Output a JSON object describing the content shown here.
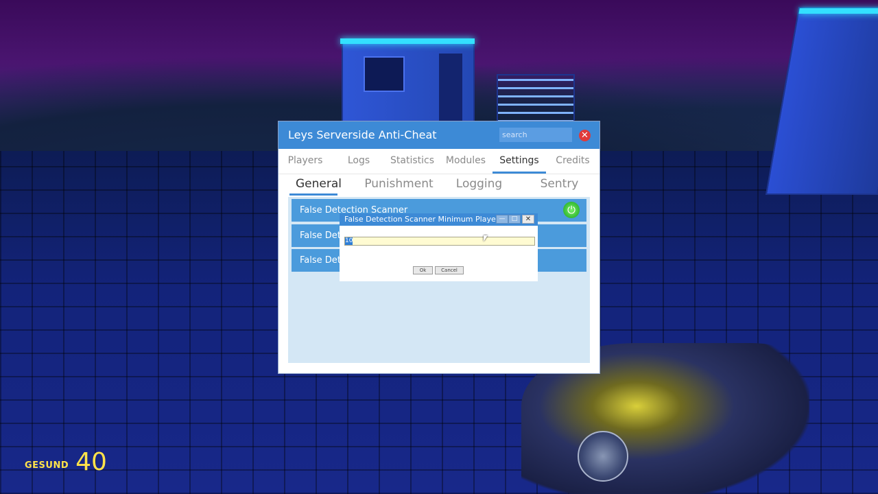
{
  "app": {
    "title": "Leys Serverside Anti-Cheat",
    "search_placeholder": "search",
    "close_glyph": "✕"
  },
  "tabs": [
    {
      "label": "Players",
      "active": false
    },
    {
      "label": "Logs",
      "active": false
    },
    {
      "label": "Statistics",
      "active": false
    },
    {
      "label": "Modules",
      "active": false
    },
    {
      "label": "Settings",
      "active": true
    },
    {
      "label": "Credits",
      "active": false
    }
  ],
  "subtabs": [
    {
      "label": "General",
      "active": true
    },
    {
      "label": "Punishment",
      "active": false
    },
    {
      "label": "Logging",
      "active": false
    },
    {
      "label": "Sentry",
      "active": false
    }
  ],
  "settings_rows": [
    {
      "label": "False Detection Scanner",
      "toggle": "on"
    },
    {
      "label": "False Dete"
    },
    {
      "label": "False Dete"
    }
  ],
  "popup": {
    "title": "False Detection Scanner Minimum Players",
    "input_value": "10",
    "ok_label": "Ok",
    "cancel_label": "Cancel",
    "min_glyph": "—",
    "max_glyph": "□",
    "close_glyph": "✕"
  },
  "hud": {
    "health_label": "GESUND",
    "health_value": "40"
  },
  "colors": {
    "accent": "#3d8ad6",
    "row": "#4b9bdc",
    "content_bg": "#d4e7f5",
    "close": "#e03a3a",
    "toggle_on": "#3dc23a",
    "hud": "#ffe24a"
  },
  "icons": {
    "close": "close-icon",
    "power": "power-icon"
  }
}
